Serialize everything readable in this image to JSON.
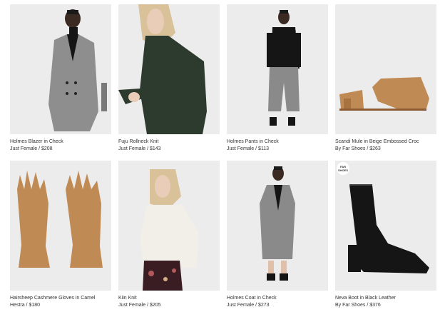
{
  "products": [
    {
      "name": "Holmes Blazer in Check",
      "meta": "Just Female / $208",
      "image": "blazer-check"
    },
    {
      "name": "Fuju Rollneck Knit",
      "meta": "Just Female / $143",
      "image": "rollneck-knit"
    },
    {
      "name": "Holmes Pants in Check",
      "meta": "Just Female / $113",
      "image": "pants-check"
    },
    {
      "name": "Scandi Mule in Beige Embossed Croc",
      "meta": "By Far Shoes / $263",
      "image": "mule-croc"
    },
    {
      "name": "Hairsheep Cashmere Gloves in Camel",
      "meta": "Hestra / $180",
      "image": "gloves-camel"
    },
    {
      "name": "Kiin Knit",
      "meta": "Just Female / $205",
      "image": "knit-white"
    },
    {
      "name": "Holmes Coat in Check",
      "meta": "Just Female / $273",
      "image": "coat-check"
    },
    {
      "name": "Neva Boot in Black Leather",
      "meta": "By Far Shoes / $376",
      "image": "boot-black",
      "badge": "FAR SHOES"
    }
  ],
  "colors": {
    "tile_background": "#ececec",
    "text": "#333333",
    "check_fabric": "#8a8a8a",
    "camel": "#c08a55",
    "dark_green": "#2d3a2e",
    "black": "#151515",
    "cream": "#f1efe8"
  }
}
